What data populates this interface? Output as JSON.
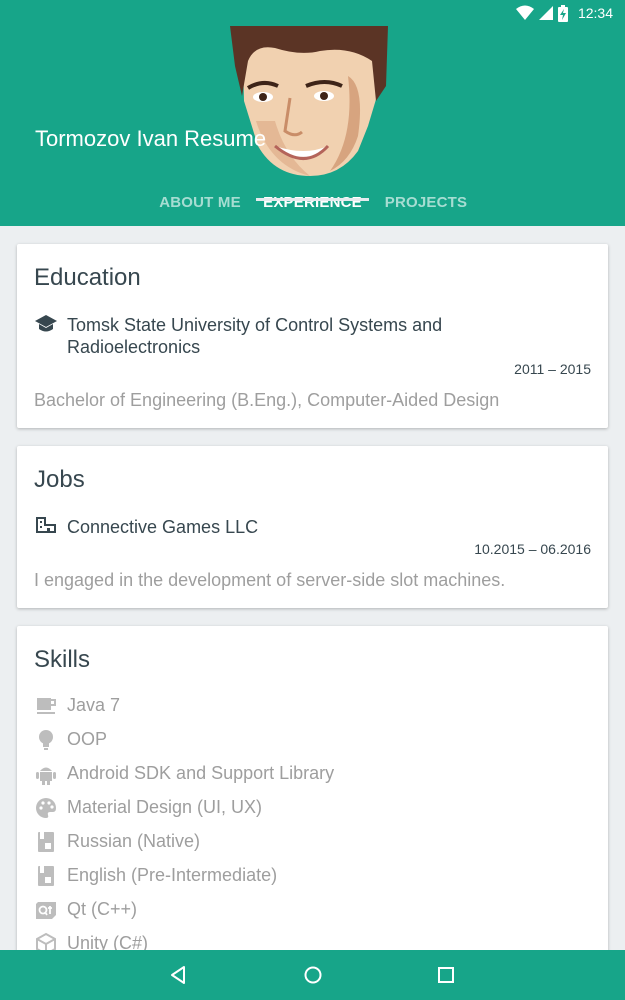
{
  "status_bar": {
    "time": "12:34",
    "icons": [
      "wifi-icon",
      "cell-signal-icon",
      "battery-charging-icon"
    ]
  },
  "header": {
    "title": "Tormozov Ivan Resume",
    "tabs": [
      {
        "label": "ABOUT ME",
        "selected": false
      },
      {
        "label": "EXPERIENCE",
        "selected": true
      },
      {
        "label": "PROJECTS",
        "selected": false
      }
    ]
  },
  "education": {
    "title": "Education",
    "icon": "graduation-cap-icon",
    "school": "Tomsk State University of Control Systems and Radioelectronics",
    "dates": "2011 – 2015",
    "degree": "Bachelor of Engineering (B.Eng.), Computer-Aided Design"
  },
  "jobs": {
    "title": "Jobs",
    "icon": "company-icon",
    "company": "Connective Games LLC",
    "dates": "10.2015 – 06.2016",
    "description": "I engaged in the development of server-side slot machines."
  },
  "skills": {
    "title": "Skills",
    "items": [
      {
        "label": "Java 7",
        "icon": "coffee-cup-icon"
      },
      {
        "label": "OOP",
        "icon": "lightbulb-icon"
      },
      {
        "label": "Android SDK and Support Library",
        "icon": "android-icon"
      },
      {
        "label": "Material Design (UI, UX)",
        "icon": "palette-icon"
      },
      {
        "label": "Russian (Native)",
        "icon": "language-book-icon"
      },
      {
        "label": "English (Pre-Intermediate)",
        "icon": "language-book-icon"
      },
      {
        "label": "Qt (C++)",
        "icon": "qt-logo-icon"
      },
      {
        "label": "Unity (C#)",
        "icon": "unity-logo-icon"
      }
    ]
  },
  "nav_bar": {
    "buttons": [
      "back-icon",
      "home-icon",
      "recents-icon"
    ]
  },
  "colors": {
    "primary": "#17a589",
    "background": "#eceff1",
    "text_dark": "#37474f",
    "text_muted": "#9e9e9e"
  }
}
